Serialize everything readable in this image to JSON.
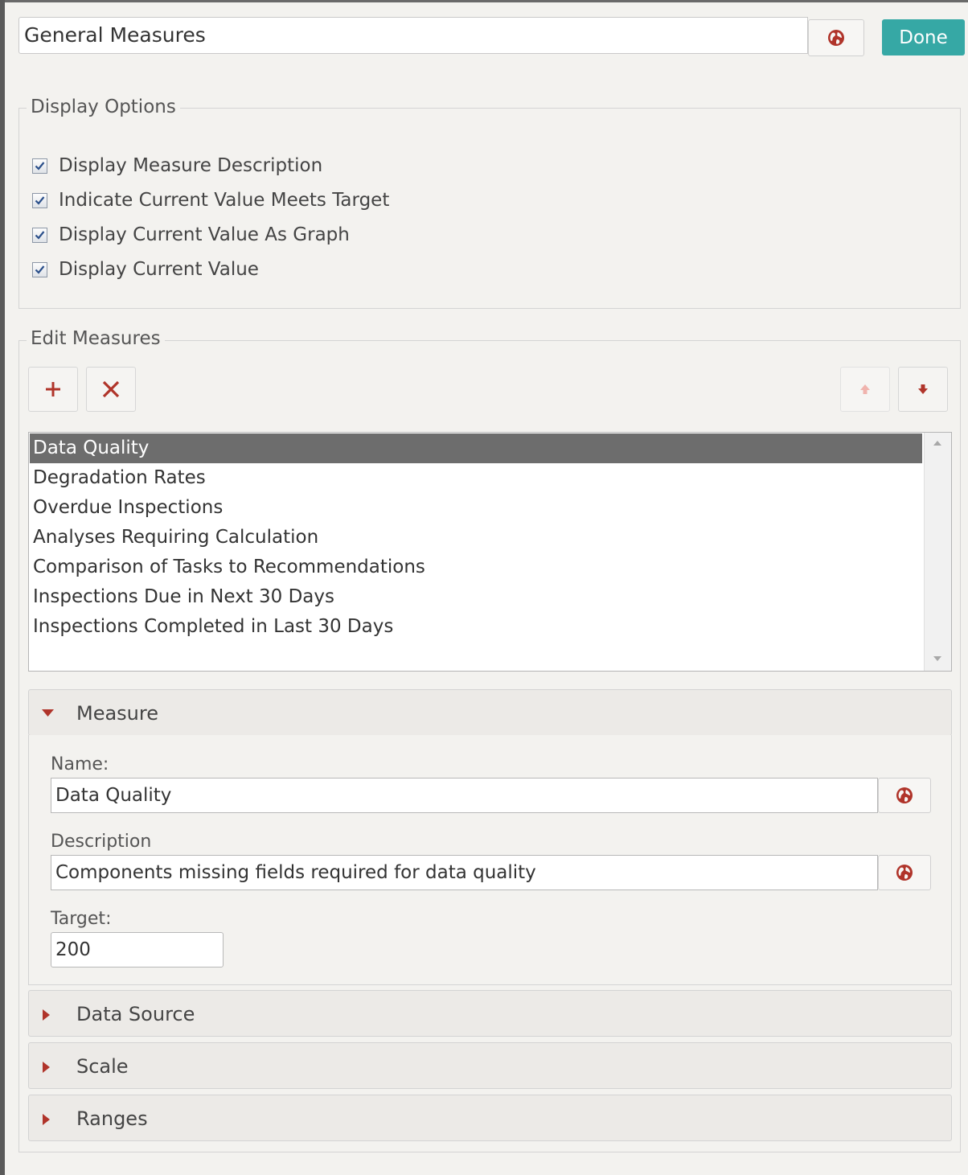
{
  "header": {
    "title_value": "General Measures",
    "done_label": "Done"
  },
  "display_options": {
    "legend": "Display Options",
    "checkboxes": [
      {
        "label": "Display Measure Description",
        "checked": true
      },
      {
        "label": "Indicate Current Value Meets Target",
        "checked": true
      },
      {
        "label": "Display Current Value As Graph",
        "checked": true
      },
      {
        "label": "Display Current Value",
        "checked": true
      }
    ]
  },
  "edit_measures": {
    "legend": "Edit Measures",
    "items": [
      "Data Quality",
      "Degradation Rates",
      "Overdue Inspections",
      "Analyses Requiring Calculation",
      "Comparison of Tasks to Recommendations",
      "Inspections Due in Next 30 Days",
      "Inspections Completed in Last 30 Days"
    ],
    "selected_index": 0
  },
  "measure_panel": {
    "title": "Measure",
    "name_label": "Name:",
    "name_value": "Data Quality",
    "description_label": "Description",
    "description_value": "Components missing fields required for data quality",
    "target_label": "Target:",
    "target_value": "200"
  },
  "collapsed_panels": [
    "Data Source",
    "Scale",
    "Ranges"
  ],
  "colors": {
    "accent": "#36a8a5",
    "icon_red": "#b0342a",
    "selected_row": "#6d6d6d"
  },
  "icons": [
    "globe-icon",
    "plus-icon",
    "close-icon",
    "arrow-up-icon",
    "arrow-down-icon",
    "caret-down-icon",
    "caret-right-icon",
    "checkbox-checked-icon"
  ]
}
